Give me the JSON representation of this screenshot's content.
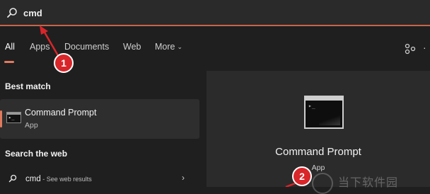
{
  "search": {
    "query": "cmd"
  },
  "tabs": [
    {
      "label": "All",
      "active": true
    },
    {
      "label": "Apps"
    },
    {
      "label": "Documents"
    },
    {
      "label": "Web"
    },
    {
      "label": "More"
    }
  ],
  "left_panel": {
    "best_match_heading": "Best match",
    "best_match": {
      "title": "Command Prompt",
      "subtitle": "App",
      "icon": "command-prompt-icon"
    },
    "web_heading": "Search the web",
    "web_result": {
      "query": "cmd",
      "suffix": " - See web results"
    }
  },
  "preview": {
    "title": "Command Prompt",
    "subtitle": "App",
    "icon": "command-prompt-icon"
  },
  "annotations": {
    "marker1": "1",
    "marker2": "2",
    "color": "#d8262a"
  },
  "watermark": {
    "text": "当下软件园"
  },
  "colors": {
    "accent": "#e07a5f",
    "background": "#1f1f1f",
    "panel": "#2b2b2b"
  }
}
